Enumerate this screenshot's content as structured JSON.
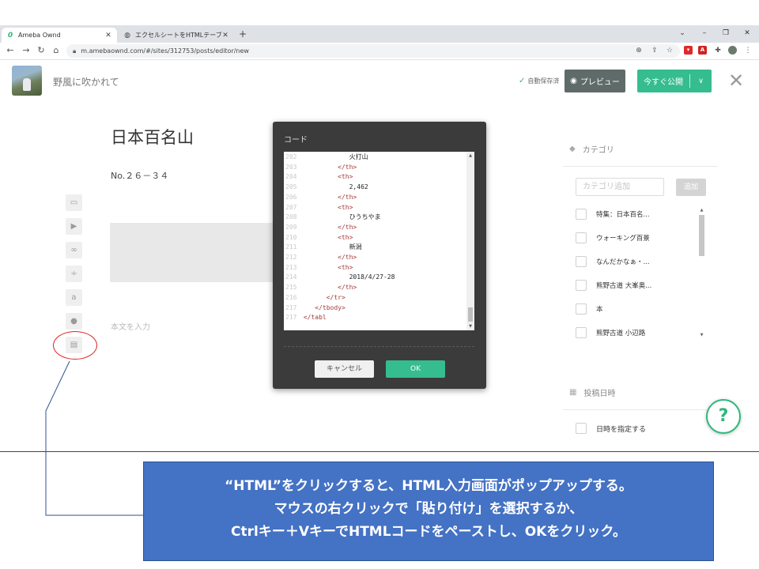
{
  "browser": {
    "tabs": [
      {
        "title": "Ameba Ownd",
        "active": true
      },
      {
        "title": "エクセルシートをHTMLテーブルに変換",
        "active": false
      }
    ],
    "new_tab": "+",
    "url": "m.amebaownd.com/#/sites/312753/posts/editor/new"
  },
  "header": {
    "site_name": "野風に吹かれて",
    "autosave": "自動保存済",
    "preview": "プレビュー",
    "publish": "今すぐ公開"
  },
  "editor": {
    "title": "日本百名山",
    "subtitle": "No.２６－３４",
    "body_placeholder": "本文を入力"
  },
  "sidebar": {
    "category_heading": "カテゴリ",
    "category_placeholder": "カテゴリ追加",
    "category_add": "追加",
    "categories": [
      "特集：日本百名...",
      "ウォーキング百景",
      "なんだかなぁ・...",
      "熊野古道 大峯奥...",
      "本",
      "熊野古道 小辺路"
    ],
    "date_heading": "投稿日時",
    "date_option": "日時を指定する",
    "help": "?"
  },
  "dialog": {
    "title": "コード",
    "code_lines": [
      {
        "ln": "202",
        "indent": "             ",
        "text": "火打山",
        "kind": "txt"
      },
      {
        "ln": "203",
        "indent": "          ",
        "text": "</th>",
        "kind": "tag"
      },
      {
        "ln": "204",
        "indent": "          ",
        "text": "<th>",
        "kind": "tag"
      },
      {
        "ln": "205",
        "indent": "             ",
        "text": "2,462",
        "kind": "txt"
      },
      {
        "ln": "206",
        "indent": "          ",
        "text": "</th>",
        "kind": "tag"
      },
      {
        "ln": "207",
        "indent": "          ",
        "text": "<th>",
        "kind": "tag"
      },
      {
        "ln": "208",
        "indent": "             ",
        "text": "ひうちやま",
        "kind": "txt"
      },
      {
        "ln": "209",
        "indent": "          ",
        "text": "</th>",
        "kind": "tag"
      },
      {
        "ln": "210",
        "indent": "          ",
        "text": "<th>",
        "kind": "tag"
      },
      {
        "ln": "211",
        "indent": "             ",
        "text": "新潟",
        "kind": "txt"
      },
      {
        "ln": "212",
        "indent": "          ",
        "text": "</th>",
        "kind": "tag"
      },
      {
        "ln": "213",
        "indent": "          ",
        "text": "<th>",
        "kind": "tag"
      },
      {
        "ln": "214",
        "indent": "             ",
        "text": "2018/4/27-28",
        "kind": "txt"
      },
      {
        "ln": "215",
        "indent": "          ",
        "text": "</th>",
        "kind": "tag"
      },
      {
        "ln": "216",
        "indent": "       ",
        "text": "</tr>",
        "kind": "tag"
      },
      {
        "ln": "217",
        "indent": "    ",
        "text": "</tbody>",
        "kind": "tag"
      },
      {
        "ln": "217",
        "indent": " ",
        "text": "</tabl",
        "kind": "tag"
      }
    ],
    "cancel": "キャンセル",
    "ok": "OK"
  },
  "annotation": {
    "lines": [
      "“HTML”をクリックすると、HTML入力画面がポップアップする。",
      "マウスの右クリックで「貼り付け」を選択するか、",
      "Ctrlキー＋VキーでHTMLコードをペーストし、OKをクリック。"
    ]
  },
  "colors": {
    "accent_green": "#35bd8f",
    "callout_blue": "#4472c4",
    "highlight_red": "#e02020"
  }
}
